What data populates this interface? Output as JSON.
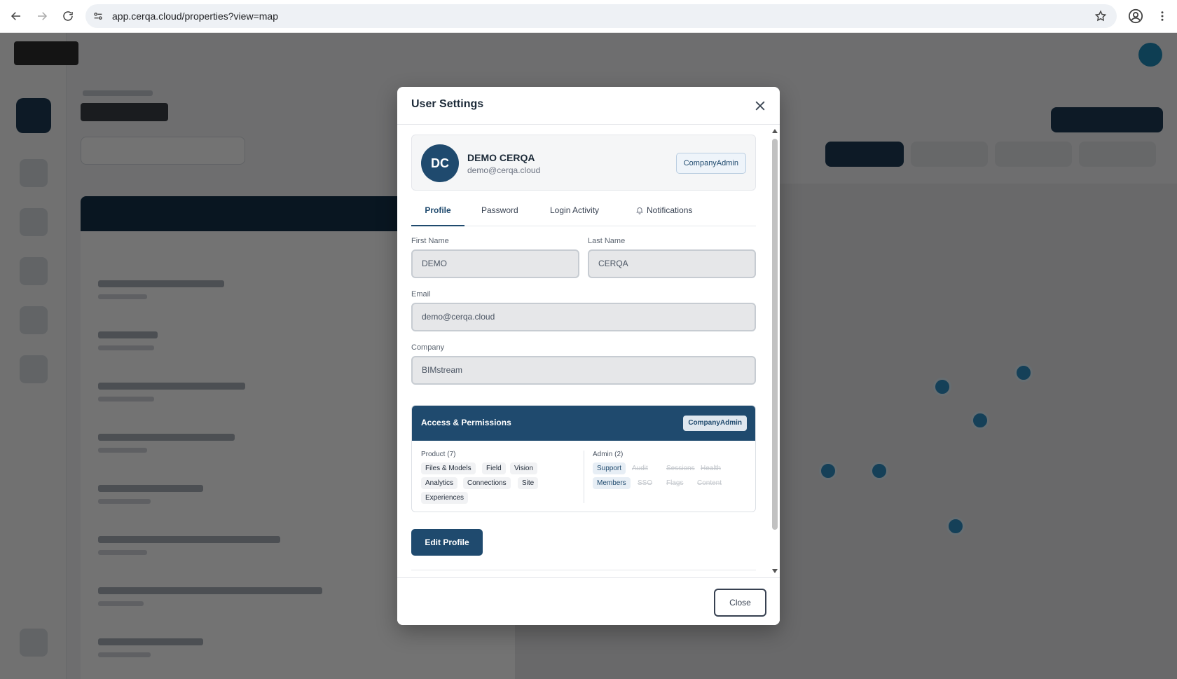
{
  "browser": {
    "url": "app.cerqa.cloud/properties?view=map"
  },
  "modal": {
    "title": "User Settings",
    "user": {
      "initials": "DC",
      "name": "DEMO CERQA",
      "email": "demo@cerqa.cloud",
      "role": "CompanyAdmin"
    },
    "tabs": [
      {
        "label": "Profile",
        "active": true
      },
      {
        "label": "Password",
        "active": false
      },
      {
        "label": "Login Activity",
        "active": false
      },
      {
        "label": "Notifications",
        "active": false,
        "icon": "bell-icon"
      }
    ],
    "fields": {
      "first_name": {
        "label": "First Name",
        "value": "DEMO"
      },
      "last_name": {
        "label": "Last Name",
        "value": "CERQA"
      },
      "email": {
        "label": "Email",
        "value": "demo@cerqa.cloud"
      },
      "company": {
        "label": "Company",
        "value": "BIMstream"
      }
    },
    "permissions": {
      "title": "Access & Permissions",
      "role_badge": "CompanyAdmin",
      "product_label": "Product (7)",
      "product": [
        "Files & Models",
        "Field",
        "Vision",
        "Analytics",
        "Connections",
        "Site",
        "Experiences"
      ],
      "admin_label": "Admin (2)",
      "admin": [
        {
          "label": "Support",
          "enabled": true
        },
        {
          "label": "Audit",
          "enabled": false
        },
        {
          "label": "Sessions",
          "enabled": false
        },
        {
          "label": "Health",
          "enabled": false
        },
        {
          "label": "Members",
          "enabled": true
        },
        {
          "label": "SSO",
          "enabled": false
        },
        {
          "label": "Flags",
          "enabled": false
        },
        {
          "label": "Content",
          "enabled": false
        }
      ]
    },
    "edit_button": "Edit Profile",
    "close_button": "Close"
  },
  "colors": {
    "primary": "#1f4a6e",
    "overlay": "rgba(0,0,0,0.55)"
  }
}
